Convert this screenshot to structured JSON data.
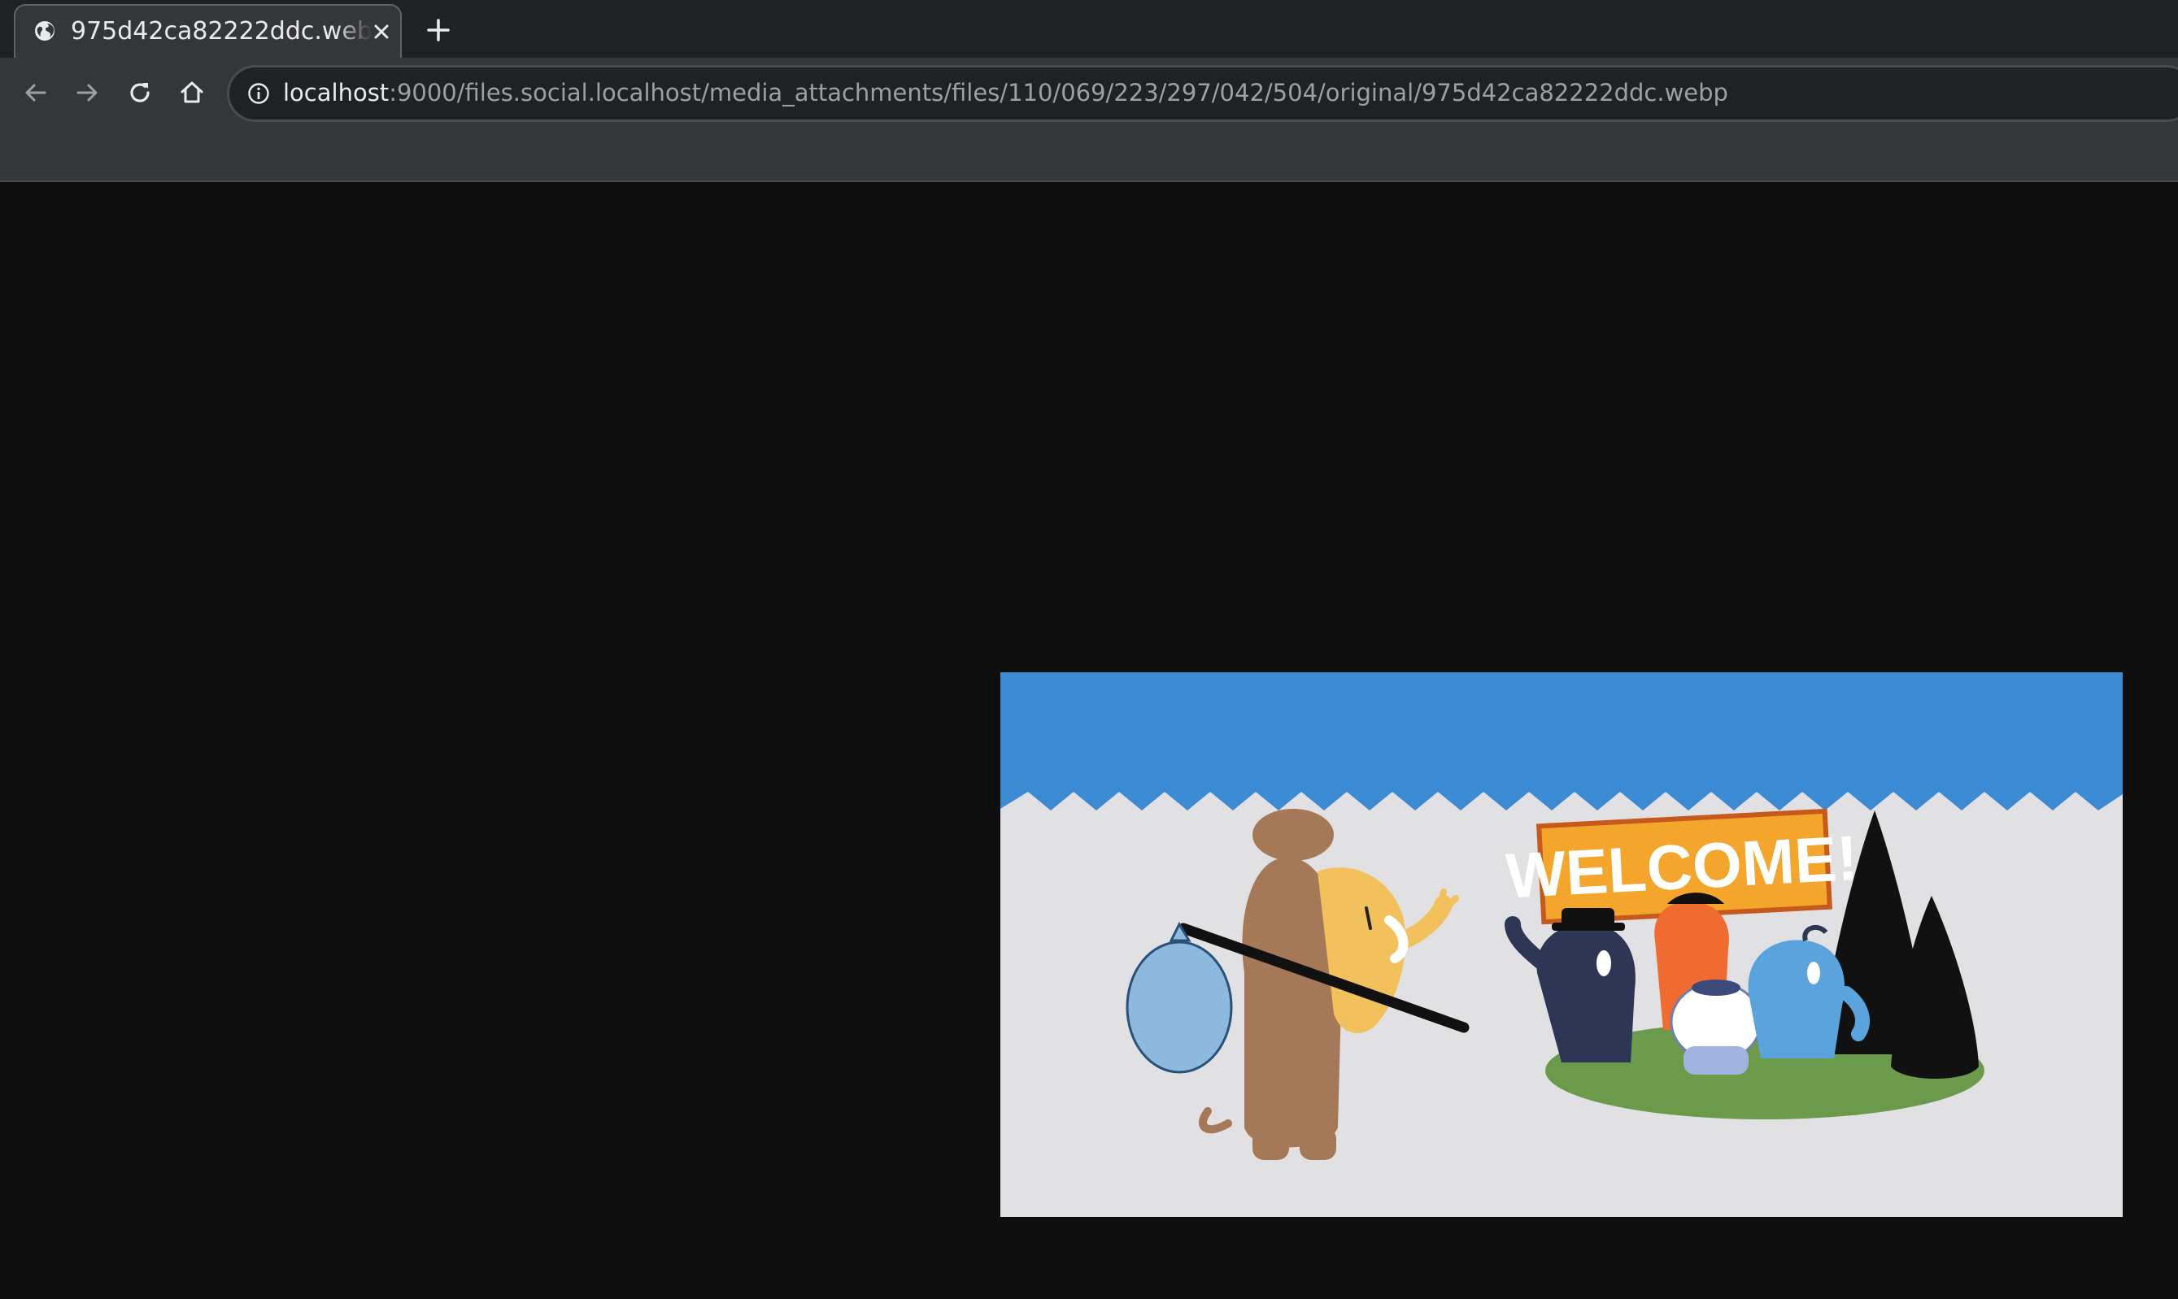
{
  "browser": {
    "tab": {
      "title": "975d42ca82222ddc.webp",
      "favicon": "globe-icon",
      "close_icon": "close-icon"
    },
    "new_tab_icon": "plus-icon",
    "nav": {
      "back_icon": "arrow-left-icon",
      "forward_icon": "arrow-right-icon",
      "reload_icon": "reload-icon",
      "home_icon": "home-icon"
    },
    "address_bar": {
      "info_icon": "info-icon",
      "url_host": "localhost",
      "url_rest": ":9000/files.social.localhost/media_attachments/files/110/069/223/297/042/504/original/975d42ca82222ddc.webp"
    }
  },
  "content": {
    "image": {
      "sign_text": "WELCOME!",
      "colors": {
        "sky": "#3c89d4",
        "ground": "#e1e1e3",
        "grass": "#6a9a4a",
        "sign": "#f3a52c"
      }
    }
  },
  "colors": {
    "page_background": "#0e0e0e",
    "tabstrip": "#202124",
    "toolbar": "#35363a"
  }
}
